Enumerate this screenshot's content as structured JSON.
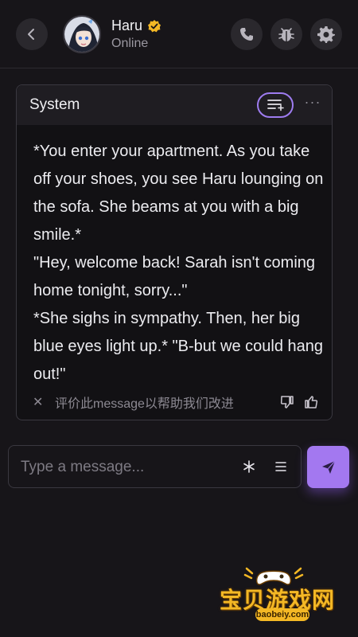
{
  "header": {
    "name": "Haru",
    "status": "Online",
    "icons": {
      "back": "chevron-left-icon",
      "verified": "verified-badge-icon",
      "call": "phone-icon",
      "bug": "bug-icon",
      "settings": "gear-icon"
    }
  },
  "message": {
    "sender": "System",
    "text": "*You enter your apartment. As you take off your shoes, you see Haru lounging on the sofa. She beams at you with a big smile.*\n\"Hey, welcome back! Sarah isn't coming home tonight, sorry...\"\n*She sighs in sympathy. Then, her big blue eyes light up.* \"B-but we could hang out!\"",
    "more_label": "···",
    "feedback": {
      "close_label": "✕",
      "prompt": "评价此message以帮助我们改进"
    }
  },
  "composer": {
    "placeholder": "Type a message...",
    "asterisk_label": "*"
  },
  "watermark": {
    "title": "宝贝游戏网",
    "url": "baobeiy.com"
  },
  "colors": {
    "background": "#171519",
    "accent": "#a378f0",
    "verified": "#f4b825"
  }
}
